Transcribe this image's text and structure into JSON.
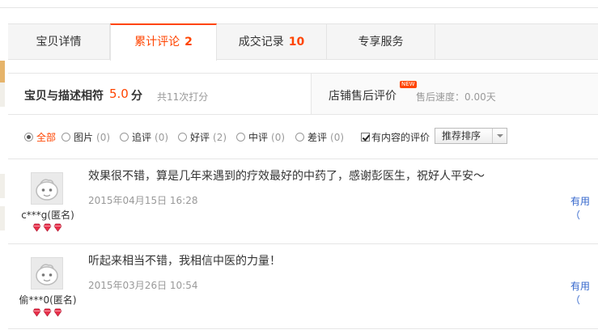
{
  "tabs": [
    {
      "label": "宝贝详情",
      "count": ""
    },
    {
      "label": "累计评论",
      "count": "2"
    },
    {
      "label": "成交记录",
      "count": "10"
    },
    {
      "label": "专享服务",
      "count": ""
    }
  ],
  "summary": {
    "desc_label": "宝贝与描述相符",
    "score": "5.0",
    "unit": "分",
    "rating_count": "共11次打分",
    "after_sales_label": "店铺售后评价",
    "new_badge": "NEW",
    "speed_text": "售后速度：0.00天"
  },
  "filters": {
    "options": [
      {
        "label": "全部",
        "count": ""
      },
      {
        "label": "图片",
        "count": "(0)"
      },
      {
        "label": "追评",
        "count": "(0)"
      },
      {
        "label": "好评",
        "count": "(2)"
      },
      {
        "label": "中评",
        "count": "(0)"
      },
      {
        "label": "差评",
        "count": "(0)"
      }
    ],
    "has_content_label": "有内容的评价",
    "sort_label": "推荐排序"
  },
  "reviews": [
    {
      "user": "c***g(匿名)",
      "content": "效果很不错，算是几年来遇到的疗效最好的中药了，感谢彭医生，祝好人平安～",
      "date": "2015年04月15日 16:28",
      "useful": "有用（"
    },
    {
      "user": "偷***0(匿名)",
      "content": "听起来相当不错，我相信中医的力量！",
      "date": "2015年03月26日 10:54",
      "useful": "有用（"
    }
  ],
  "colors": {
    "accent": "#ff4400",
    "link": "#3366cc",
    "gem": "#e8304a"
  }
}
